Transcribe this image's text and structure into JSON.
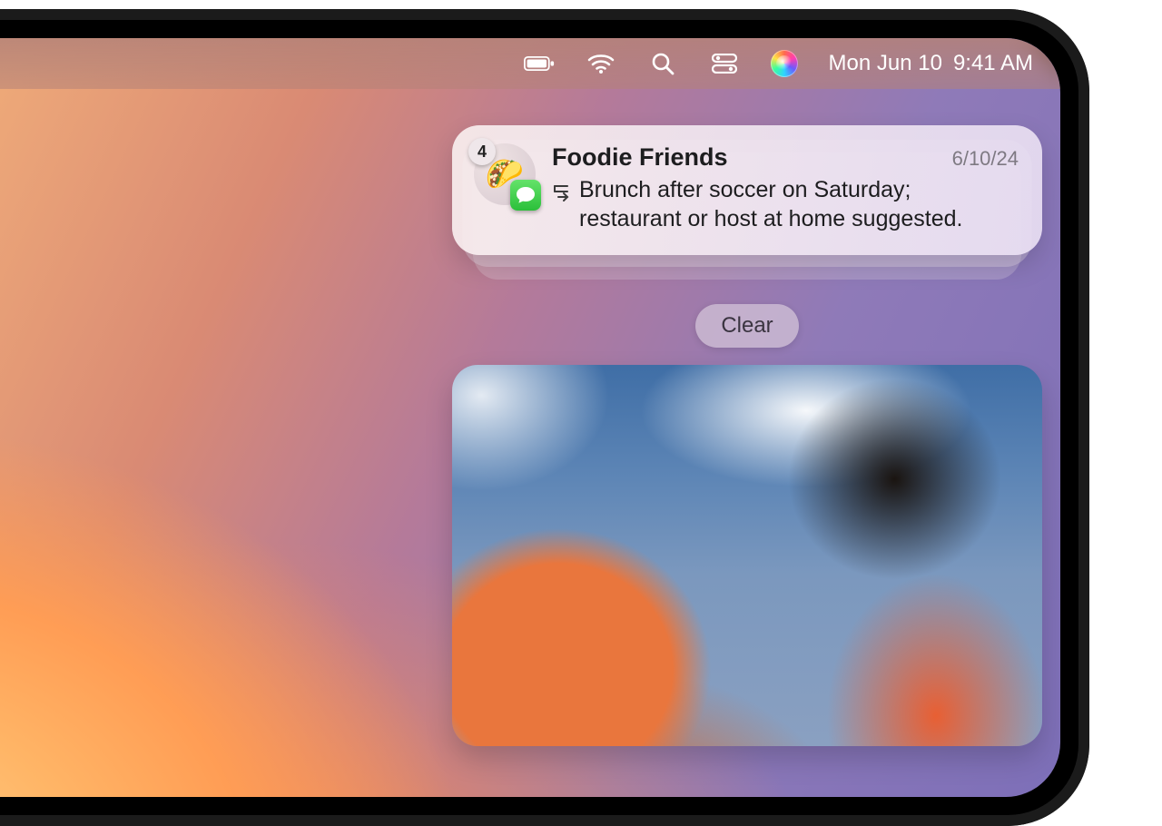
{
  "menubar": {
    "date": "Mon Jun 10",
    "time": "9:41 AM"
  },
  "notification": {
    "count": "4",
    "group_emoji": "🌮",
    "title": "Foodie Friends",
    "timestamp": "6/10/24",
    "summary": "Brunch after soccer on Saturday; restaurant or host at home suggested."
  },
  "actions": {
    "clear_label": "Clear"
  }
}
